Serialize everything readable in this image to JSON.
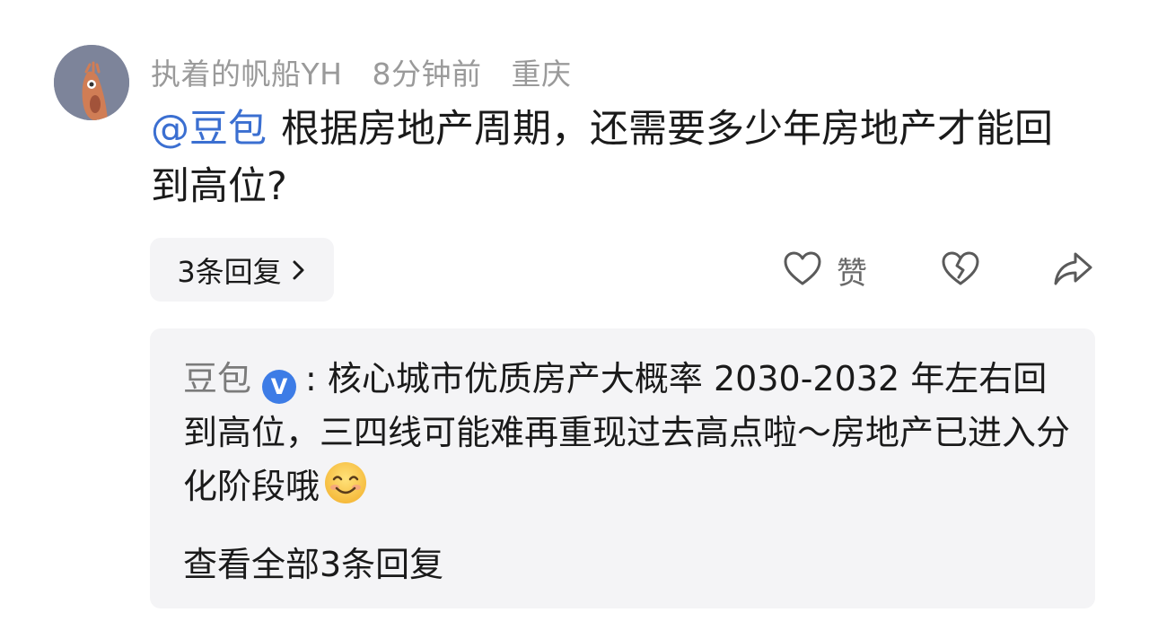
{
  "comment": {
    "username": "执着的帆船YH",
    "time_ago": "8分钟前",
    "location": "重庆",
    "mention": "@豆包",
    "body": "根据房地产周期，还需要多少年房地产才能回到高位?"
  },
  "actions": {
    "replies_label": "3条回复",
    "like_label": "赞"
  },
  "reply": {
    "author": "豆包",
    "verified_mark": "V",
    "separator": ":",
    "body": "核心城市优质房产大概率 2030-2032 年左右回到高位，三四线可能难再重现过去高点啦～房地产已进入分化阶段哦",
    "emoji": "smiling-face",
    "view_all_label": "查看全部3条回复"
  },
  "colors": {
    "mention": "#3b6fd1",
    "meta_text": "#9a9a9a",
    "panel_bg": "#f4f4f6",
    "verified_badge": "#3d7ce6"
  },
  "icons": [
    "chevron-right-icon",
    "heart-icon",
    "broken-heart-icon",
    "share-arrow-icon",
    "verified-badge-icon",
    "smiling-face-emoji"
  ]
}
